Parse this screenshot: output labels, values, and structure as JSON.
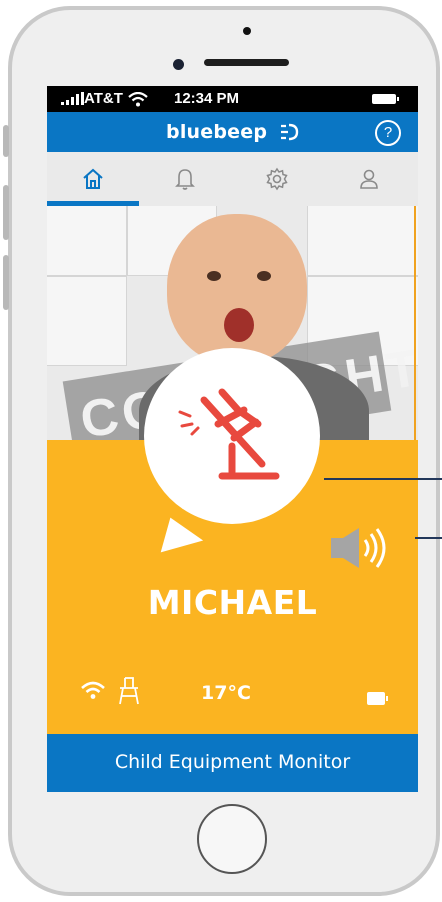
{
  "status_bar": {
    "carrier": "AT&T",
    "time": "12:34 PM"
  },
  "app_bar": {
    "brand": "bluebeep",
    "help_label": "?"
  },
  "tabs": [
    {
      "name": "home-icon",
      "active": true
    },
    {
      "name": "bell-icon",
      "active": false
    },
    {
      "name": "gear-icon",
      "active": false
    },
    {
      "name": "user-icon",
      "active": false
    }
  ],
  "photo": {
    "watermark": "COPYRIGHT"
  },
  "alert_card": {
    "icon": "highchair-alert-icon",
    "sound_icon": "speaker-icon",
    "child_name": "MICHAEL",
    "temperature": "17°C"
  },
  "footer": {
    "title": "Child Equipment Monitor"
  },
  "colors": {
    "brand_blue": "#0a76c4",
    "alert_yellow": "#fbb421",
    "alert_red": "#e8493e"
  }
}
